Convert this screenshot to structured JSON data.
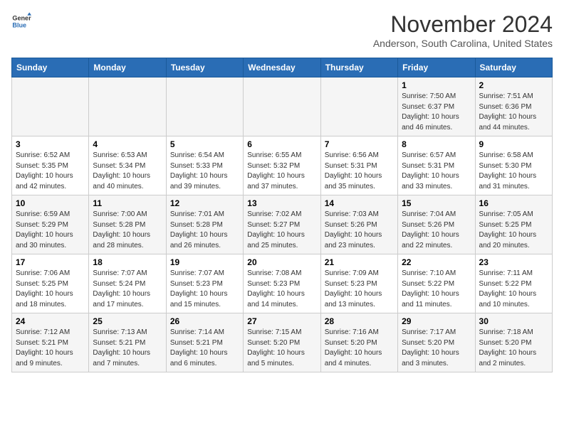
{
  "header": {
    "logo_line1": "General",
    "logo_line2": "Blue",
    "month": "November 2024",
    "location": "Anderson, South Carolina, United States"
  },
  "weekdays": [
    "Sunday",
    "Monday",
    "Tuesday",
    "Wednesday",
    "Thursday",
    "Friday",
    "Saturday"
  ],
  "weeks": [
    [
      {
        "day": "",
        "info": ""
      },
      {
        "day": "",
        "info": ""
      },
      {
        "day": "",
        "info": ""
      },
      {
        "day": "",
        "info": ""
      },
      {
        "day": "",
        "info": ""
      },
      {
        "day": "1",
        "info": "Sunrise: 7:50 AM\nSunset: 6:37 PM\nDaylight: 10 hours\nand 46 minutes."
      },
      {
        "day": "2",
        "info": "Sunrise: 7:51 AM\nSunset: 6:36 PM\nDaylight: 10 hours\nand 44 minutes."
      }
    ],
    [
      {
        "day": "3",
        "info": "Sunrise: 6:52 AM\nSunset: 5:35 PM\nDaylight: 10 hours\nand 42 minutes."
      },
      {
        "day": "4",
        "info": "Sunrise: 6:53 AM\nSunset: 5:34 PM\nDaylight: 10 hours\nand 40 minutes."
      },
      {
        "day": "5",
        "info": "Sunrise: 6:54 AM\nSunset: 5:33 PM\nDaylight: 10 hours\nand 39 minutes."
      },
      {
        "day": "6",
        "info": "Sunrise: 6:55 AM\nSunset: 5:32 PM\nDaylight: 10 hours\nand 37 minutes."
      },
      {
        "day": "7",
        "info": "Sunrise: 6:56 AM\nSunset: 5:31 PM\nDaylight: 10 hours\nand 35 minutes."
      },
      {
        "day": "8",
        "info": "Sunrise: 6:57 AM\nSunset: 5:31 PM\nDaylight: 10 hours\nand 33 minutes."
      },
      {
        "day": "9",
        "info": "Sunrise: 6:58 AM\nSunset: 5:30 PM\nDaylight: 10 hours\nand 31 minutes."
      }
    ],
    [
      {
        "day": "10",
        "info": "Sunrise: 6:59 AM\nSunset: 5:29 PM\nDaylight: 10 hours\nand 30 minutes."
      },
      {
        "day": "11",
        "info": "Sunrise: 7:00 AM\nSunset: 5:28 PM\nDaylight: 10 hours\nand 28 minutes."
      },
      {
        "day": "12",
        "info": "Sunrise: 7:01 AM\nSunset: 5:28 PM\nDaylight: 10 hours\nand 26 minutes."
      },
      {
        "day": "13",
        "info": "Sunrise: 7:02 AM\nSunset: 5:27 PM\nDaylight: 10 hours\nand 25 minutes."
      },
      {
        "day": "14",
        "info": "Sunrise: 7:03 AM\nSunset: 5:26 PM\nDaylight: 10 hours\nand 23 minutes."
      },
      {
        "day": "15",
        "info": "Sunrise: 7:04 AM\nSunset: 5:26 PM\nDaylight: 10 hours\nand 22 minutes."
      },
      {
        "day": "16",
        "info": "Sunrise: 7:05 AM\nSunset: 5:25 PM\nDaylight: 10 hours\nand 20 minutes."
      }
    ],
    [
      {
        "day": "17",
        "info": "Sunrise: 7:06 AM\nSunset: 5:25 PM\nDaylight: 10 hours\nand 18 minutes."
      },
      {
        "day": "18",
        "info": "Sunrise: 7:07 AM\nSunset: 5:24 PM\nDaylight: 10 hours\nand 17 minutes."
      },
      {
        "day": "19",
        "info": "Sunrise: 7:07 AM\nSunset: 5:23 PM\nDaylight: 10 hours\nand 15 minutes."
      },
      {
        "day": "20",
        "info": "Sunrise: 7:08 AM\nSunset: 5:23 PM\nDaylight: 10 hours\nand 14 minutes."
      },
      {
        "day": "21",
        "info": "Sunrise: 7:09 AM\nSunset: 5:23 PM\nDaylight: 10 hours\nand 13 minutes."
      },
      {
        "day": "22",
        "info": "Sunrise: 7:10 AM\nSunset: 5:22 PM\nDaylight: 10 hours\nand 11 minutes."
      },
      {
        "day": "23",
        "info": "Sunrise: 7:11 AM\nSunset: 5:22 PM\nDaylight: 10 hours\nand 10 minutes."
      }
    ],
    [
      {
        "day": "24",
        "info": "Sunrise: 7:12 AM\nSunset: 5:21 PM\nDaylight: 10 hours\nand 9 minutes."
      },
      {
        "day": "25",
        "info": "Sunrise: 7:13 AM\nSunset: 5:21 PM\nDaylight: 10 hours\nand 7 minutes."
      },
      {
        "day": "26",
        "info": "Sunrise: 7:14 AM\nSunset: 5:21 PM\nDaylight: 10 hours\nand 6 minutes."
      },
      {
        "day": "27",
        "info": "Sunrise: 7:15 AM\nSunset: 5:20 PM\nDaylight: 10 hours\nand 5 minutes."
      },
      {
        "day": "28",
        "info": "Sunrise: 7:16 AM\nSunset: 5:20 PM\nDaylight: 10 hours\nand 4 minutes."
      },
      {
        "day": "29",
        "info": "Sunrise: 7:17 AM\nSunset: 5:20 PM\nDaylight: 10 hours\nand 3 minutes."
      },
      {
        "day": "30",
        "info": "Sunrise: 7:18 AM\nSunset: 5:20 PM\nDaylight: 10 hours\nand 2 minutes."
      }
    ]
  ],
  "colors": {
    "header_bg": "#2a6db5",
    "odd_row_bg": "#f5f5f5",
    "even_row_bg": "#ffffff"
  }
}
